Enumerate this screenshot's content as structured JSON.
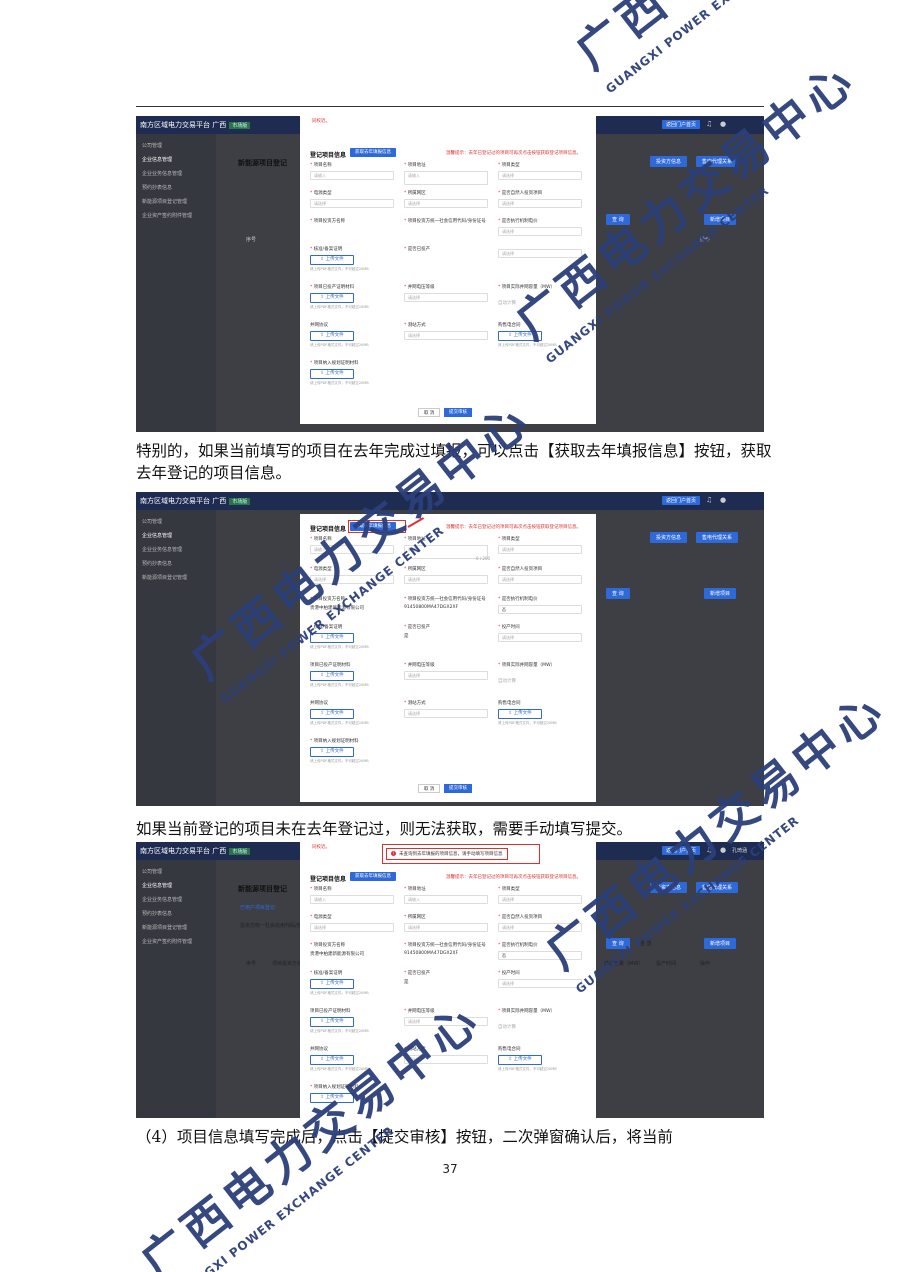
{
  "page_number": "37",
  "paragraphs": {
    "p1": "特别的，如果当前填写的项目在去年完成过填报，可以点击【获取去年填报信息】按钮，获取去年登记的项目信息。",
    "p2": "如果当前登记的项目未在去年登记过，则无法获取，需要手动填写提交。",
    "p3": "（4）项目信息填写完成后，点击【提交审核】按钮，二次弹窗确认后，将当前"
  },
  "watermark": {
    "cn": "广西电力交易中心",
    "en": "GUANGXI POWER EXCHANGE CENTER"
  },
  "app": {
    "brand": "南方区域电力交易平台",
    "brand_region": "广西",
    "brand_tag": "市场版",
    "switch_btn": "返回门户首页",
    "user": "孔琦涵",
    "sidebar": [
      "公司管理",
      "企业信息管理",
      "企业业务信息管理",
      "预约抄表信息",
      "新能源项目登记管理",
      "企业资产签约附件管理"
    ],
    "page_title": "新能源项目登记",
    "btn_invest": "投资方信息",
    "btn_agent": "售电代理关系",
    "btn_query": "查 询",
    "btn_reset": "重 置",
    "btn_add": "新增项目",
    "tab_label": "已用户项目登记",
    "investor_filter": "投资方统一社会信用代码/身份",
    "col_no": "序号",
    "col_investor": "项目投资方名称",
    "col_capacity": "装机容量（MW）",
    "col_time": "投产时间",
    "col_op": "操作"
  },
  "modal": {
    "top_note": "同校近。",
    "title": "登记项目信息",
    "fetch_btn": "获取去年填报信息",
    "tip": "温馨提示：去年已登记过的项目可再次点击按钮获取登记项目信息。",
    "fields": {
      "name": "项目名称",
      "address": "项目地址",
      "type": "项目类型",
      "power_type": "电源类型",
      "district": "所属网区",
      "self_invest": "是否自然人投资项目",
      "investor_name": "项目投资方名称",
      "investor_code": "项目投资方统一社会信用代码/身份证号",
      "exec_price": "是否执行机制电价",
      "record": "核准/备案证明",
      "grid_done": "是否已投产",
      "op_time": "投产时间",
      "grid_proof": "项目已投产证明材料",
      "grid_voltage": "并网电压等级",
      "grid_capacity": "项目实际并网容量（MW）",
      "grid_agreement": "并网协议",
      "measure": "测站方式",
      "purchase_contract": "购售电合同",
      "plan_proof": "项目纳入规划证明材料"
    },
    "placeholder_input": "请输入",
    "placeholder_select": "请选择",
    "counter": "0 / 200",
    "investor_company": "贵港中柏建新能源有限公司",
    "investor_credit": "91450800MA47DGX2XF",
    "exec_price_val": "否",
    "grid_done_val": "是",
    "auto_calc": "自动计算",
    "upload": "上传文件",
    "upload_hint": "请上传PDF格式文件，不可超过20MB",
    "cancel": "取 消",
    "submit": "提交审核",
    "error_msg": "未查询到去年填报的项目信息，请手动填写项目信息"
  },
  "colors": {
    "accent": "#2e69d9",
    "warning": "#e03030",
    "watermark": "#2b3f7a"
  }
}
